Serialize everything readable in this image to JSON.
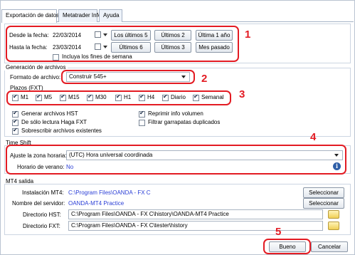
{
  "tabs": [
    "Exportación de datos",
    "Metatrader Info",
    "Ayuda"
  ],
  "dates": {
    "from_label": "Desde la fecha:",
    "from_value": "22/03/2014",
    "to_label": "Hasta la fecha:",
    "to_value": "23/03/2014",
    "weekend_label": "Incluya los fines de semana",
    "buttons": [
      "Los últimos 5",
      "Últimos 2",
      "Última 1 año",
      "Últimos 6",
      "Últimos 3",
      "Mes pasado"
    ]
  },
  "generation": {
    "title": "Generación de archivos",
    "format_label": "Formato de archivo:",
    "format_value": "Construir 545+",
    "plazos_title": "Plazos (FXT)",
    "timeframes": [
      "M1",
      "M5",
      "M15",
      "M30",
      "H1",
      "H4",
      "Diario",
      "Semanal"
    ],
    "options_left": [
      "Generar archivos HST",
      "De sólo lectura Haga FXT",
      "Sobrescribir archivos existentes"
    ],
    "options_right": [
      "Reprimir info volumen",
      "Filtrar garrapatas duplicados"
    ]
  },
  "timeshift": {
    "title": "Time Shift",
    "zone_label": "Ajuste la zona horaria:",
    "zone_value": "(UTC) Hora universal coordinada",
    "summer_label": "Horario de verano:",
    "summer_value": "No"
  },
  "mt4": {
    "title": "MT4 salida",
    "install_label": "Instalación MT4:",
    "install_value": "C:\\Program Files\\OANDA - FX C",
    "server_label": "Nombre del servidor:",
    "server_value": "OANDA-MT4 Practice",
    "hst_label": "Directorio HST:",
    "hst_value": "C:\\Program Files\\OANDA - FX C\\history\\OANDA-MT4 Practice",
    "fxt_label": "Directorio FXT:",
    "fxt_value": "C:\\Program Files\\OANDA - FX C\\tester\\history",
    "select_label": "Seleccionar"
  },
  "footer": {
    "ok_label": "Bueno",
    "cancel_label": "Cancelar"
  },
  "annotations": [
    "1",
    "2",
    "3",
    "4",
    "5"
  ],
  "colors": {
    "annotation": "#e31b23",
    "link_blue": "#2a3ed6"
  }
}
